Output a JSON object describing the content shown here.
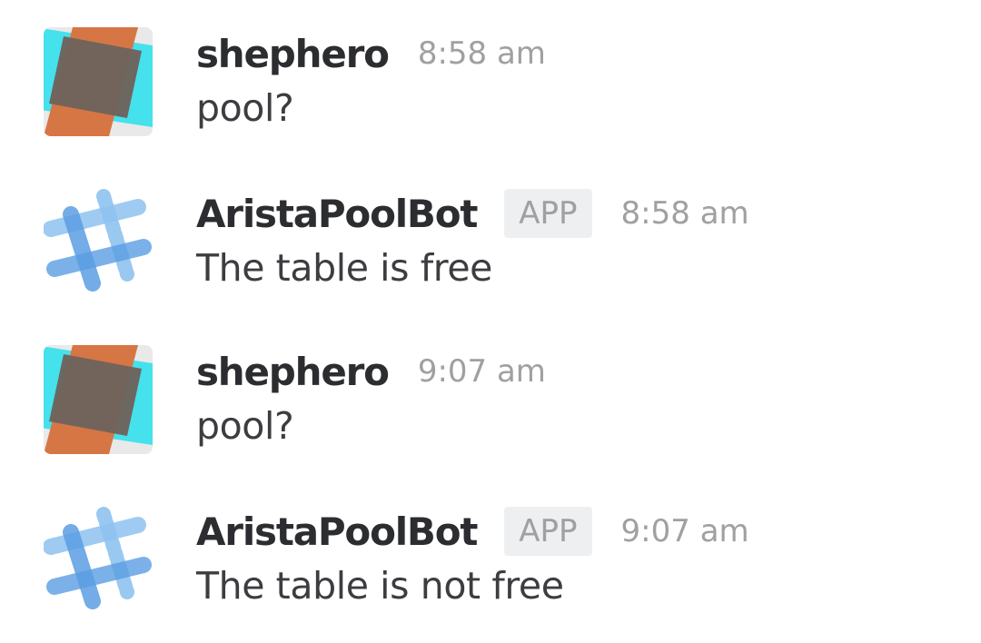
{
  "messages": [
    {
      "sender": "shephero",
      "time": "8:58 am",
      "text": "pool?",
      "avatar": "user-avatar-icon"
    },
    {
      "sender": "AristaPoolBot",
      "badge": "APP",
      "time": "8:58 am",
      "text": "The table is free",
      "avatar": "bot-avatar-icon"
    },
    {
      "sender": "shephero",
      "time": "9:07 am",
      "text": "pool?",
      "avatar": "user-avatar-icon"
    },
    {
      "sender": "AristaPoolBot",
      "badge": "APP",
      "time": "9:07 am",
      "text": "The table is not free",
      "avatar": "bot-avatar-icon"
    }
  ],
  "colors": {
    "background": "#ffffff",
    "sender_text": "#2c2d30",
    "body_text": "#3d3c40",
    "muted_text": "#a0a0a2",
    "badge_bg": "#eeeff1",
    "user_avatar_cyan": "#45e1ec",
    "user_avatar_orange": "#d67645",
    "user_avatar_center": "#6e635c",
    "bot_avatar_blue": "#5b9ee3",
    "bot_avatar_light_blue": "#8fc3f0"
  }
}
